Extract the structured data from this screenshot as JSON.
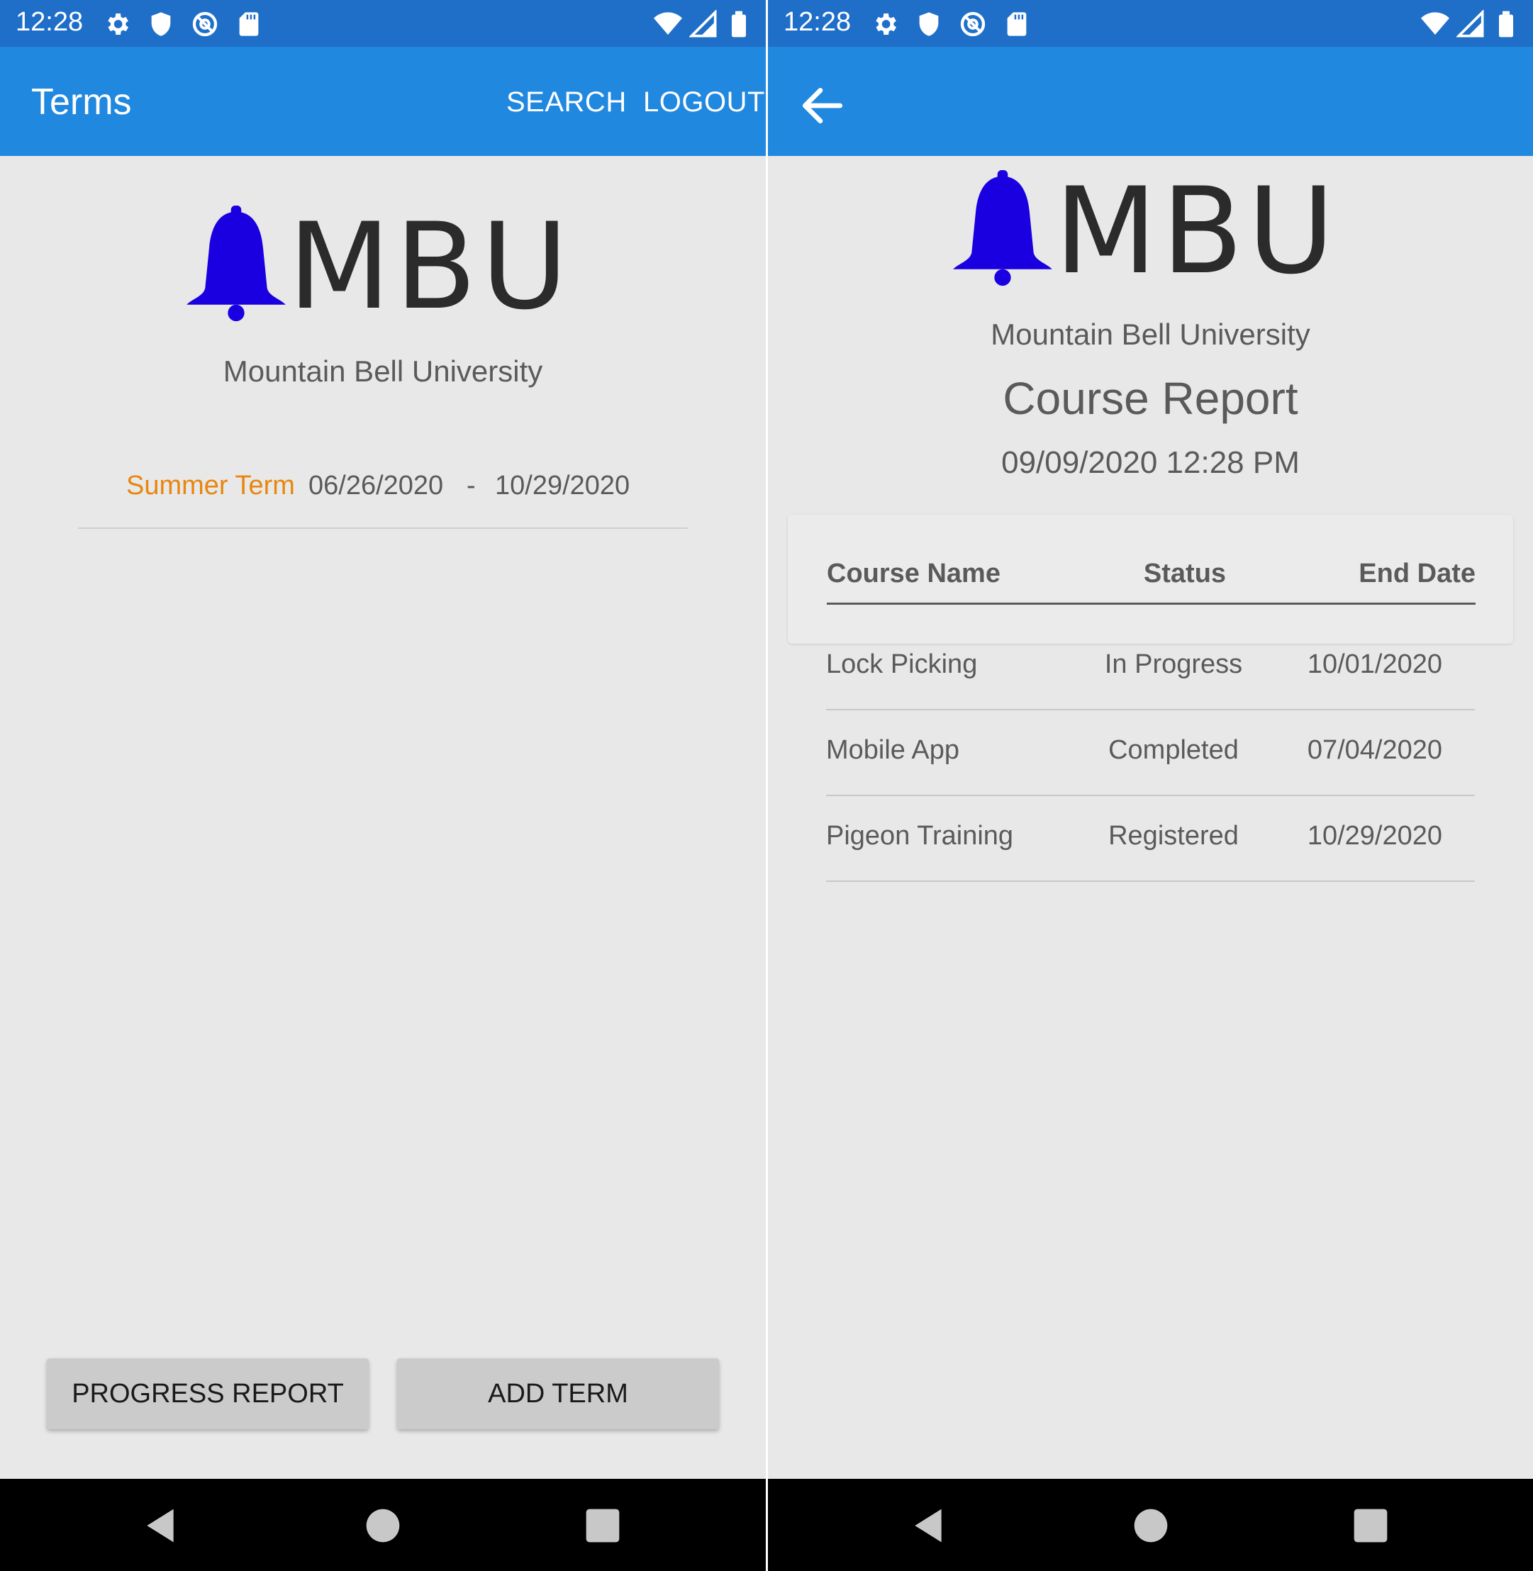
{
  "left_screen": {
    "status_bar": {
      "time": "12:28",
      "icons_left": [
        "settings-icon",
        "shield-icon",
        "at-sign-icon",
        "sd-card-icon"
      ],
      "icons_right": [
        "wifi-icon",
        "signal-icon",
        "battery-icon"
      ]
    },
    "app_bar": {
      "title": "Terms",
      "actions": {
        "search": "SEARCH",
        "logout": "LOGOUT"
      }
    },
    "logo": {
      "text": "MBU",
      "icon": "bell-icon",
      "icon_color": "#1a00e0"
    },
    "university_name": "Mountain Bell University",
    "terms": [
      {
        "name": "Summer Term",
        "start": "06/26/2020",
        "separator": "-",
        "end": "10/29/2020"
      }
    ],
    "buttons": {
      "progress_report": "PROGRESS REPORT",
      "add_term": "ADD TERM"
    }
  },
  "right_screen": {
    "status_bar": {
      "time": "12:28"
    },
    "logo": {
      "text": "MBU"
    },
    "university_name": "Mountain Bell University",
    "report_title": "Course Report",
    "report_datetime": "09/09/2020 12:28 PM",
    "table": {
      "headers": {
        "course_name": "Course Name",
        "status": "Status",
        "end_date": "End Date"
      },
      "rows": [
        {
          "course_name": "Lock Picking",
          "status": "In Progress",
          "end_date": "10/01/2020"
        },
        {
          "course_name": "Mobile App",
          "status": "Completed",
          "end_date": "07/04/2020"
        },
        {
          "course_name": "Pigeon Training",
          "status": "Registered",
          "end_date": "10/29/2020"
        }
      ]
    }
  },
  "colors": {
    "status_bar": "#1f6fc9",
    "app_bar": "#2188e0",
    "accent_orange": "#e8860e",
    "background": "#e8e8e8"
  }
}
